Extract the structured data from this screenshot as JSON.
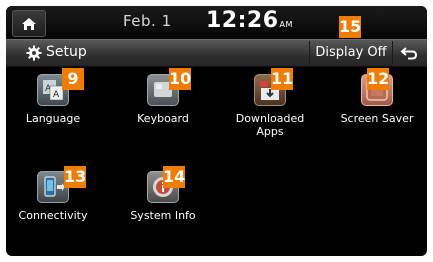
{
  "status_bar": {
    "date": "Feb.  1",
    "time": "12:26",
    "ampm": "AM"
  },
  "header": {
    "title": "Setup",
    "display_off_label": "Display Off"
  },
  "callouts": {
    "display_off": "15",
    "language": "9",
    "keyboard": "10",
    "downloaded_apps": "11",
    "screen_saver": "12",
    "connectivity": "13",
    "system_info": "14"
  },
  "apps": {
    "language": "Language",
    "keyboard": "Keyboard",
    "downloaded_apps_line1": "Downloaded",
    "downloaded_apps_line2": "Apps",
    "screen_saver": "Screen Saver",
    "connectivity": "Connectivity",
    "system_info": "System Info"
  },
  "colors": {
    "callout": "#f07c00",
    "screen_bg": "#000000",
    "text": "#ffffff"
  },
  "icons": {
    "home": "home-icon",
    "setup": "gear-icon",
    "back": "back-arrow-icon"
  }
}
